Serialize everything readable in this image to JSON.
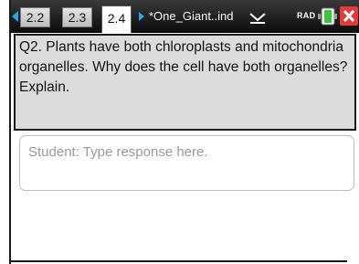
{
  "tabs": [
    {
      "label": "2.2",
      "active": false
    },
    {
      "label": "2.3",
      "active": false
    },
    {
      "label": "2.4",
      "active": true
    }
  ],
  "document": {
    "title": "*One_Giant..ind"
  },
  "status": {
    "mode": "RAD"
  },
  "icons": {
    "prev_page": "left-arrow-icon",
    "next_page": "right-arrow-icon",
    "document_menu": "chevron-down-icon",
    "battery": "battery-icon",
    "close": "close-icon"
  },
  "question": {
    "text": "Q2. Plants have both chloroplasts and mitochondria organelles.  Why does the cell have both organelles? Explain."
  },
  "response": {
    "placeholder": "Student: Type response here.",
    "value": ""
  },
  "colors": {
    "accent": "#2fa3e6",
    "battery": "#3cc63c",
    "close": "#e23b3b",
    "question_background": "#dcdcdc"
  }
}
